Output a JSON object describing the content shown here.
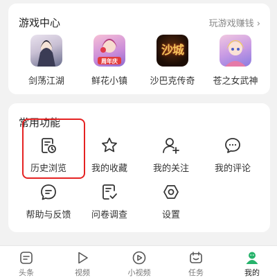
{
  "games": {
    "title": "游戏中心",
    "link": "玩游戏赚钱 ›",
    "items": [
      {
        "name": "剑荡江湖"
      },
      {
        "name": "鲜花小镇",
        "badge": "周年庆"
      },
      {
        "name": "沙巴克传奇",
        "art_text": "沙城"
      },
      {
        "name": "苍之女武神"
      }
    ]
  },
  "functions": {
    "title": "常用功能",
    "items": [
      {
        "label": "历史浏览",
        "icon": "history-icon"
      },
      {
        "label": "我的收藏",
        "icon": "star-icon"
      },
      {
        "label": "我的关注",
        "icon": "add-user-icon"
      },
      {
        "label": "我的评论",
        "icon": "comment-icon"
      },
      {
        "label": "帮助与反馈",
        "icon": "help-feedback-icon"
      },
      {
        "label": "问卷调查",
        "icon": "survey-icon"
      },
      {
        "label": "设置",
        "icon": "settings-icon"
      }
    ]
  },
  "tabbar": {
    "items": [
      {
        "label": "头条",
        "icon": "headline-icon"
      },
      {
        "label": "视频",
        "icon": "play-icon"
      },
      {
        "label": "小视频",
        "icon": "mini-video-icon"
      },
      {
        "label": "任务",
        "icon": "task-icon"
      },
      {
        "label": "我的",
        "icon": "profile-icon",
        "active": true
      }
    ]
  },
  "colors": {
    "highlight": "#e52222",
    "active_tab": "#27b36b",
    "icon": "#333333"
  }
}
